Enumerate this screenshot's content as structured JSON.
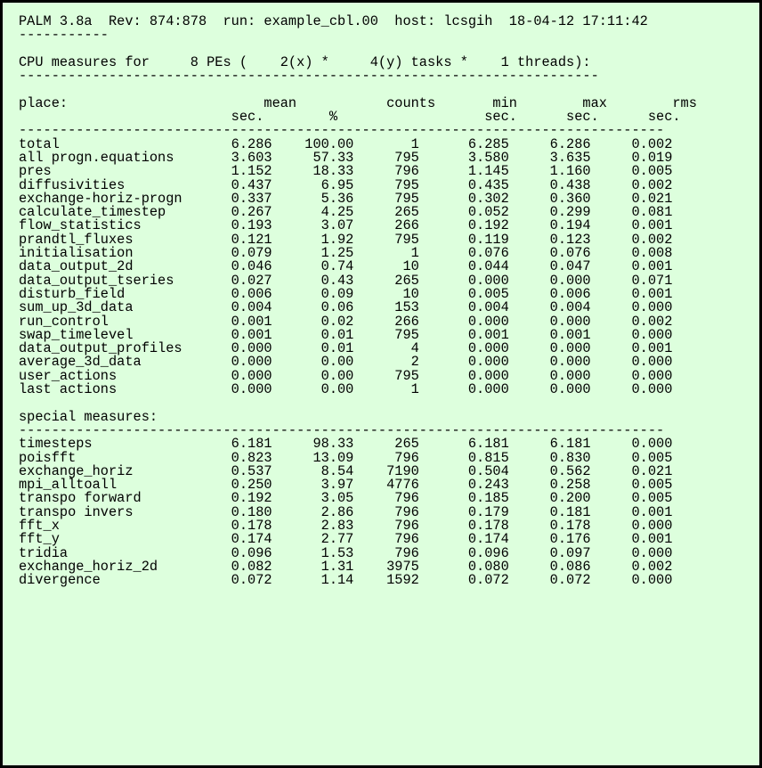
{
  "header": {
    "program": "PALM 3.8a",
    "rev_label": "Rev:",
    "rev": "874:878",
    "run_label": "run:",
    "run": "example_cbl.00",
    "host_label": "host:",
    "host": "lcsgih",
    "timestamp": "18-04-12 17:11:42",
    "dashes": "-----------"
  },
  "cpu_line": {
    "prefix": "CPU measures for",
    "pes": "8",
    "pes_label": "PEs (",
    "x": "2(x)",
    "star1": "*",
    "y": "4(y)",
    "tasks_label": "tasks *",
    "threads": "1",
    "threads_label": "threads):"
  },
  "rule_short": "-----------------------------------------------------------------------",
  "rule_long": "-------------------------------------------------------------------------------",
  "cols": {
    "place": "place:",
    "mean": "mean",
    "counts": "counts",
    "min": "min",
    "max": "max",
    "rms": "rms",
    "sec": "sec.",
    "pct": "%"
  },
  "rows": [
    {
      "name": "total",
      "mean": "6.286",
      "pct": "100.00",
      "counts": "1",
      "min": "6.285",
      "max": "6.286",
      "rms": "0.002"
    },
    {
      "name": "all progn.equations",
      "mean": "3.603",
      "pct": "57.33",
      "counts": "795",
      "min": "3.580",
      "max": "3.635",
      "rms": "0.019"
    },
    {
      "name": "pres",
      "mean": "1.152",
      "pct": "18.33",
      "counts": "796",
      "min": "1.145",
      "max": "1.160",
      "rms": "0.005"
    },
    {
      "name": "diffusivities",
      "mean": "0.437",
      "pct": "6.95",
      "counts": "795",
      "min": "0.435",
      "max": "0.438",
      "rms": "0.002"
    },
    {
      "name": "exchange-horiz-progn",
      "mean": "0.337",
      "pct": "5.36",
      "counts": "795",
      "min": "0.302",
      "max": "0.360",
      "rms": "0.021"
    },
    {
      "name": "calculate_timestep",
      "mean": "0.267",
      "pct": "4.25",
      "counts": "265",
      "min": "0.052",
      "max": "0.299",
      "rms": "0.081"
    },
    {
      "name": "flow_statistics",
      "mean": "0.193",
      "pct": "3.07",
      "counts": "266",
      "min": "0.192",
      "max": "0.194",
      "rms": "0.001"
    },
    {
      "name": "prandtl_fluxes",
      "mean": "0.121",
      "pct": "1.92",
      "counts": "795",
      "min": "0.119",
      "max": "0.123",
      "rms": "0.002"
    },
    {
      "name": "initialisation",
      "mean": "0.079",
      "pct": "1.25",
      "counts": "1",
      "min": "0.076",
      "max": "0.076",
      "rms": "0.008"
    },
    {
      "name": "data_output_2d",
      "mean": "0.046",
      "pct": "0.74",
      "counts": "10",
      "min": "0.044",
      "max": "0.047",
      "rms": "0.001"
    },
    {
      "name": "data_output_tseries",
      "mean": "0.027",
      "pct": "0.43",
      "counts": "265",
      "min": "0.000",
      "max": "0.000",
      "rms": "0.071"
    },
    {
      "name": "disturb_field",
      "mean": "0.006",
      "pct": "0.09",
      "counts": "10",
      "min": "0.005",
      "max": "0.006",
      "rms": "0.001"
    },
    {
      "name": "sum_up_3d_data",
      "mean": "0.004",
      "pct": "0.06",
      "counts": "153",
      "min": "0.004",
      "max": "0.004",
      "rms": "0.000"
    },
    {
      "name": "run_control",
      "mean": "0.001",
      "pct": "0.02",
      "counts": "266",
      "min": "0.000",
      "max": "0.000",
      "rms": "0.002"
    },
    {
      "name": "swap_timelevel",
      "mean": "0.001",
      "pct": "0.01",
      "counts": "795",
      "min": "0.001",
      "max": "0.001",
      "rms": "0.000"
    },
    {
      "name": "data_output_profiles",
      "mean": "0.000",
      "pct": "0.01",
      "counts": "4",
      "min": "0.000",
      "max": "0.000",
      "rms": "0.001"
    },
    {
      "name": "average_3d_data",
      "mean": "0.000",
      "pct": "0.00",
      "counts": "2",
      "min": "0.000",
      "max": "0.000",
      "rms": "0.000"
    },
    {
      "name": "user_actions",
      "mean": "0.000",
      "pct": "0.00",
      "counts": "795",
      "min": "0.000",
      "max": "0.000",
      "rms": "0.000"
    },
    {
      "name": "last actions",
      "mean": "0.000",
      "pct": "0.00",
      "counts": "1",
      "min": "0.000",
      "max": "0.000",
      "rms": "0.000"
    }
  ],
  "special_label": "special measures:",
  "special_rows": [
    {
      "name": "timesteps",
      "mean": "6.181",
      "pct": "98.33",
      "counts": "265",
      "min": "6.181",
      "max": "6.181",
      "rms": "0.000"
    },
    {
      "name": "poisfft",
      "mean": "0.823",
      "pct": "13.09",
      "counts": "796",
      "min": "0.815",
      "max": "0.830",
      "rms": "0.005"
    },
    {
      "name": "exchange_horiz",
      "mean": "0.537",
      "pct": "8.54",
      "counts": "7190",
      "min": "0.504",
      "max": "0.562",
      "rms": "0.021"
    },
    {
      "name": "mpi_alltoall",
      "mean": "0.250",
      "pct": "3.97",
      "counts": "4776",
      "min": "0.243",
      "max": "0.258",
      "rms": "0.005"
    },
    {
      "name": "transpo forward",
      "mean": "0.192",
      "pct": "3.05",
      "counts": "796",
      "min": "0.185",
      "max": "0.200",
      "rms": "0.005"
    },
    {
      "name": "transpo invers",
      "mean": "0.180",
      "pct": "2.86",
      "counts": "796",
      "min": "0.179",
      "max": "0.181",
      "rms": "0.001"
    },
    {
      "name": "fft_x",
      "mean": "0.178",
      "pct": "2.83",
      "counts": "796",
      "min": "0.178",
      "max": "0.178",
      "rms": "0.000"
    },
    {
      "name": "fft_y",
      "mean": "0.174",
      "pct": "2.77",
      "counts": "796",
      "min": "0.174",
      "max": "0.176",
      "rms": "0.001"
    },
    {
      "name": "tridia",
      "mean": "0.096",
      "pct": "1.53",
      "counts": "796",
      "min": "0.096",
      "max": "0.097",
      "rms": "0.000"
    },
    {
      "name": "exchange_horiz_2d",
      "mean": "0.082",
      "pct": "1.31",
      "counts": "3975",
      "min": "0.080",
      "max": "0.086",
      "rms": "0.002"
    },
    {
      "name": "divergence",
      "mean": "0.072",
      "pct": "1.14",
      "counts": "1592",
      "min": "0.072",
      "max": "0.072",
      "rms": "0.000"
    }
  ]
}
